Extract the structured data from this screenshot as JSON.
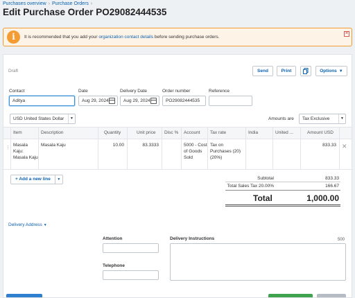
{
  "breadcrumb": {
    "items": [
      "Purchases overview",
      "Purchase Orders"
    ],
    "separator": "›"
  },
  "page": {
    "title": "Edit Purchase Order PO29082444535"
  },
  "alert": {
    "icon": "info-icon",
    "text_before": "It is recommended that you add your ",
    "link_text": "organization contact details",
    "text_after": " before sending purchase orders.",
    "close_glyph": "✕",
    "accent_color": "#f39c34"
  },
  "status": "Draft",
  "toolbar": {
    "send_label": "Send",
    "print_label": "Print",
    "copy_icon": "copy-icon",
    "options_label": "Options"
  },
  "form": {
    "contact_label": "Contact",
    "contact_value": "Aditya",
    "date_label": "Date",
    "date_value": "Aug 29, 2024",
    "delivery_date_label": "Delivery Date",
    "delivery_date_value": "Aug 29, 2024",
    "order_number_label": "Order number",
    "order_number_value": "PO29082444535",
    "reference_label": "Reference",
    "reference_value": ""
  },
  "currency": {
    "value": "USD United States Dollar"
  },
  "amounts": {
    "label": "Amounts are",
    "value": "Tax Exclusive"
  },
  "table": {
    "headers": {
      "item": "Item",
      "description": "Description",
      "quantity": "Quantity",
      "unit_price": "Unit price",
      "disc": "Disc %",
      "account": "Account",
      "tax_rate": "Tax rate",
      "india": "India",
      "united": "United ...",
      "amount": "Amount USD"
    },
    "rows": [
      {
        "item": "Masala Kaju: Masala Kaju",
        "description": "Masala Kaju",
        "quantity": "10.00",
        "unit_price": "83.3333",
        "disc": "",
        "account": "5000 - Cost of Goods Sold",
        "tax_rate": "Tax on Purchases (20) (20%)",
        "india": "",
        "united": "",
        "amount": "833.33"
      }
    ]
  },
  "add_line": {
    "label": "+ Add a new line"
  },
  "totals": {
    "subtotal_label": "Subtotal",
    "subtotal_value": "833.33",
    "tax_label": "Total Sales Tax 20.00%",
    "tax_value": "166.67",
    "total_label": "Total",
    "total_value": "1,000.00"
  },
  "delivery": {
    "toggle_label": "Delivery Address",
    "attention_label": "Attention",
    "telephone_label": "Telephone",
    "instructions_label": "Delivery Instructions",
    "instructions_counter": "500"
  },
  "colors": {
    "link": "#0b61b0",
    "save_green": "#3fa34d",
    "approve_blue": "#2f7fd1"
  }
}
